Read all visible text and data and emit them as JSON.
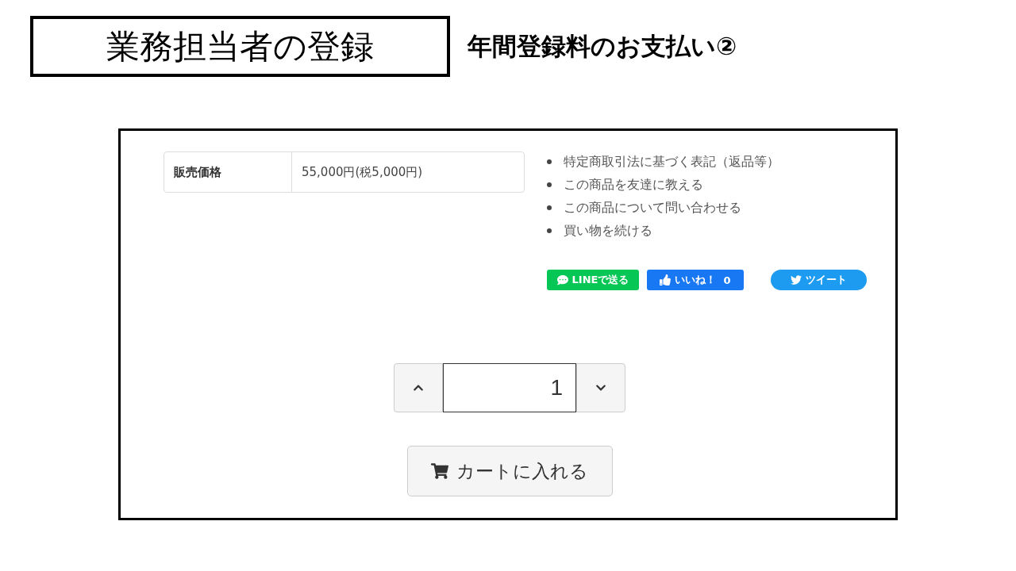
{
  "header": {
    "title": "業務担当者の登録",
    "subtitle": "年間登録料のお支払い②"
  },
  "price_table": {
    "label": "販売価格",
    "value": "55,000円(税5,000円)"
  },
  "links": [
    "特定商取引法に基づく表記（返品等）",
    "この商品を友達に教える",
    "この商品について問い合わせる",
    "買い物を続ける"
  ],
  "share_buttons": [
    {
      "kind": "line",
      "label": "LINEで送る"
    },
    {
      "kind": "like",
      "label": "いいね！",
      "count": "0"
    },
    {
      "kind": "tweet",
      "label": "ツイート"
    }
  ],
  "quantity": {
    "value": "1"
  },
  "cart_button": {
    "label": "カートに入れる"
  }
}
